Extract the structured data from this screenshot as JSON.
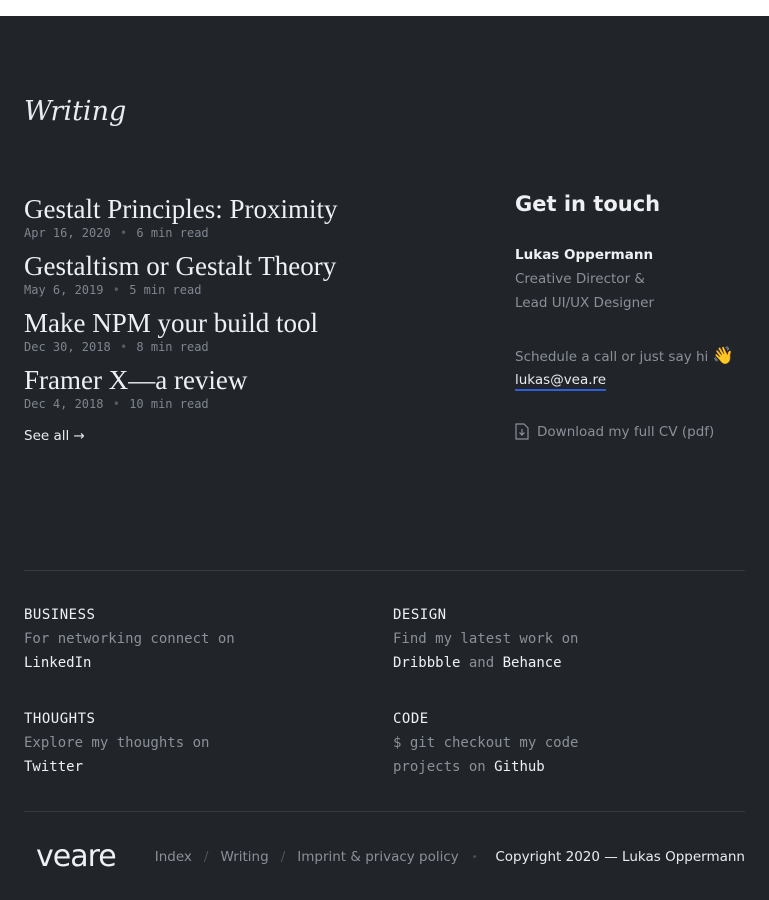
{
  "writing": {
    "title": "Writing",
    "posts": [
      {
        "title": "Gestalt Principles: Proximity",
        "date": "Apr 16, 2020",
        "read": "6 min read"
      },
      {
        "title": "Gestaltism or Gestalt Theory",
        "date": "May 6, 2019",
        "read": "5 min read"
      },
      {
        "title": "Make NPM your build tool",
        "date": "Dec 30, 2018",
        "read": "8 min read"
      },
      {
        "title": "Framer X—a review",
        "date": "Dec 4, 2018",
        "read": "10 min read"
      }
    ],
    "see_all": "See all →",
    "separator": "•"
  },
  "contact": {
    "heading": "Get in touch",
    "name": "Lukas Oppermann",
    "role_line1": "Creative Director &",
    "role_line2": "Lead UI/UX Designer",
    "call_text": "Schedule a call or just say hi",
    "wave_emoji": "👋",
    "email": "lukas@vea.re",
    "cv_label": "Download my full CV (pdf)",
    "cv_icon": "document-download-icon",
    "accent_color": "#2f5fd8"
  },
  "social": {
    "business": {
      "label": "BUSINESS",
      "desc": "For networking connect on",
      "link": "LinkedIn"
    },
    "design": {
      "label": "DESIGN",
      "desc": "Find my latest work on",
      "link1": "Dribbble",
      "conj": "and",
      "link2": "Behance"
    },
    "thoughts": {
      "label": "THOUGHTS",
      "desc": "Explore my thoughts on",
      "link": "Twitter"
    },
    "code": {
      "label": "CODE",
      "desc1": "$ git checkout my code",
      "desc2": "projects on",
      "link": "Github"
    }
  },
  "footer": {
    "logo": "veare",
    "nav": [
      "Index",
      "Writing",
      "Imprint & privacy policy"
    ],
    "slash": "/",
    "bullet": "•",
    "copyright": "Copyright 2020 — Lukas Oppermann"
  },
  "colors": {
    "background": "#212429",
    "text": "#eef0f3",
    "muted": "#8a9099"
  }
}
